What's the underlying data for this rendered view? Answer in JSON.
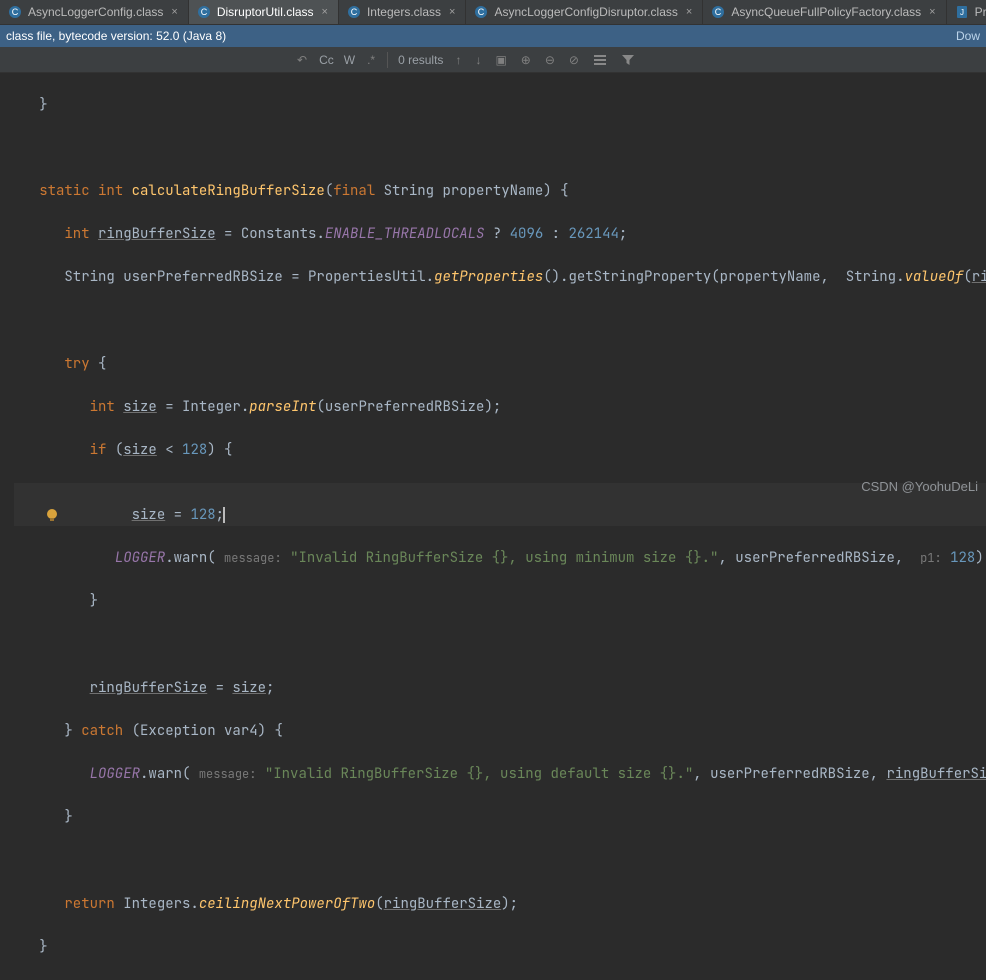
{
  "tabs": [
    {
      "label": "AsyncLoggerConfig.class",
      "icon": "class",
      "active": false
    },
    {
      "label": "DisruptorUtil.class",
      "icon": "class",
      "active": true
    },
    {
      "label": "Integers.class",
      "icon": "class",
      "active": false
    },
    {
      "label": "AsyncLoggerConfigDisruptor.class",
      "icon": "class",
      "active": false
    },
    {
      "label": "AsyncQueueFullPolicyFactory.class",
      "icon": "class",
      "active": false
    },
    {
      "label": "PropertiesUtil.java",
      "icon": "file",
      "active": false
    }
  ],
  "infobar": {
    "left": "class file, bytecode version: 52.0 (Java 8)",
    "right": "Dow"
  },
  "findbar": {
    "results": "0 results",
    "opts": {
      "cc": "Cc",
      "w": "W"
    }
  },
  "code": {
    "kw_static": "static",
    "kw_int": "int",
    "kw_final": "final",
    "kw_if": "if",
    "kw_try": "try",
    "kw_catch": "catch",
    "kw_return": "return",
    "method_name": "calculateRingBufferSize",
    "param_type": "String",
    "param_name": "propertyName",
    "ringBufferSize": "ringBufferSize",
    "Constants": "Constants",
    "ENABLE_THREADLOCALS": "ENABLE_THREADLOCALS",
    "n4096": "4096",
    "n262144": "262144",
    "String": "String",
    "userPref": "userPreferredRBSize",
    "PropertiesUtil": "PropertiesUtil",
    "getProperties": "getProperties",
    "getStringProperty": "getStringProperty",
    "valueOf": "valueOf",
    "size": "size",
    "Integer": "Integer",
    "parseInt": "parseInt",
    "n128": "128",
    "LOGGER": "LOGGER",
    "warn": "warn",
    "hint_message": "message:",
    "hint_p1": "p1:",
    "msg_min": "\"Invalid RingBufferSize {}, using minimum size {}.\"",
    "msg_def": "\"Invalid RingBufferSize {}, using default size {}.\"",
    "Exception": "Exception",
    "var4": "var4",
    "Integers": "Integers",
    "ceilingNextPowerOfTwo": "ceilingNextPowerOfTwo"
  },
  "watermark": "CSDN @YoohuDeLi"
}
